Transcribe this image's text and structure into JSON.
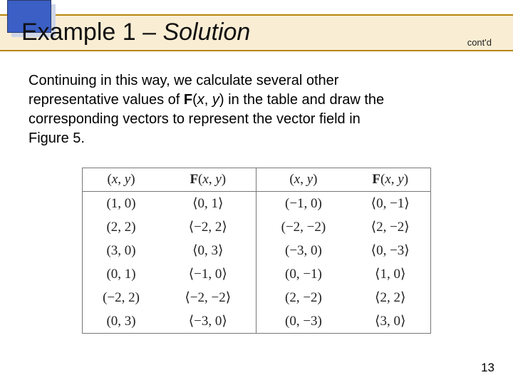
{
  "header": {
    "title_prefix": "Example 1 – ",
    "title_solution": "Solution",
    "contd": "cont'd"
  },
  "body": {
    "line1": "Continuing in this way, we calculate several other",
    "line2a": "representative values of ",
    "line2b_F": "F",
    "line2c": "(",
    "line2d_x": "x",
    "line2e": ", ",
    "line2f_y": "y",
    "line2g": ") in the table and draw the",
    "line3": "corresponding vectors to represent the vector field in",
    "line4": "Figure 5."
  },
  "table": {
    "headers": {
      "c1a": "(",
      "c1x": "x",
      "c1m": ", ",
      "c1y": "y",
      "c1b": ")",
      "c2F": "F",
      "c2a": "(",
      "c2x": "x",
      "c2m": ", ",
      "c2y": "y",
      "c2b": ")",
      "c3a": "(",
      "c3x": "x",
      "c3m": ", ",
      "c3y": "y",
      "c3b": ")",
      "c4F": "F",
      "c4a": "(",
      "c4x": "x",
      "c4m": ", ",
      "c4y": "y",
      "c4b": ")"
    },
    "rows": [
      {
        "p1": "(1, 0)",
        "f1": "⟨0, 1⟩",
        "p2": "(−1, 0)",
        "f2": "⟨0, −1⟩"
      },
      {
        "p1": "(2, 2)",
        "f1": "⟨−2, 2⟩",
        "p2": "(−2, −2)",
        "f2": "⟨2, −2⟩"
      },
      {
        "p1": "(3, 0)",
        "f1": "⟨0, 3⟩",
        "p2": "(−3, 0)",
        "f2": "⟨0, −3⟩"
      },
      {
        "p1": "(0, 1)",
        "f1": "⟨−1, 0⟩",
        "p2": "(0, −1)",
        "f2": "⟨1, 0⟩"
      },
      {
        "p1": "(−2, 2)",
        "f1": "⟨−2, −2⟩",
        "p2": "(2, −2)",
        "f2": "⟨2, 2⟩"
      },
      {
        "p1": "(0, 3)",
        "f1": "⟨−3, 0⟩",
        "p2": "(0, −3)",
        "f2": "⟨3, 0⟩"
      }
    ]
  },
  "page_number": "13"
}
